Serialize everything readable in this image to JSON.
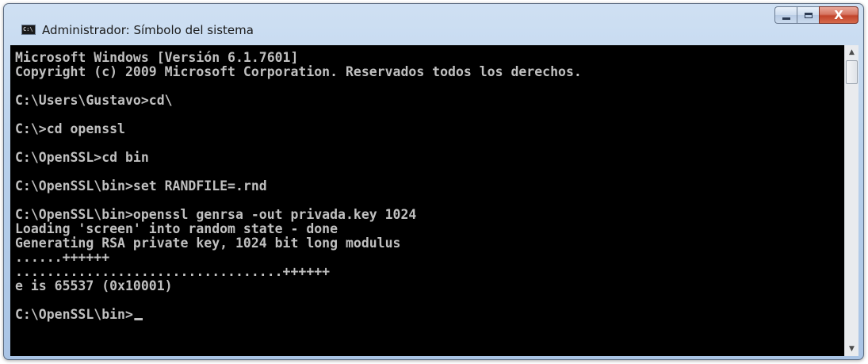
{
  "window": {
    "title": "Administrador: Símbolo del sistema",
    "icon_label": "C:\\",
    "close_glyph": "X"
  },
  "console": {
    "lines": [
      "Microsoft Windows [Versión 6.1.7601]",
      "Copyright (c) 2009 Microsoft Corporation. Reservados todos los derechos.",
      "",
      "C:\\Users\\Gustavo>cd\\",
      "",
      "C:\\>cd openssl",
      "",
      "C:\\OpenSSL>cd bin",
      "",
      "C:\\OpenSSL\\bin>set RANDFILE=.rnd",
      "",
      "C:\\OpenSSL\\bin>openssl genrsa -out privada.key 1024",
      "Loading 'screen' into random state - done",
      "Generating RSA private key, 1024 bit long modulus",
      "......++++++",
      "..................................++++++",
      "e is 65537 (0x10001)",
      "",
      "C:\\OpenSSL\\bin>"
    ]
  },
  "colors": {
    "console_background": "#000000",
    "console_text": "#c0c0c0",
    "close_button": "#c1432b"
  },
  "icons": {
    "app": "cmd-icon",
    "minimize": "minimize-icon",
    "maximize": "maximize-icon",
    "close": "close-icon",
    "scroll_up": "scroll-up-arrow-icon",
    "scroll_down": "scroll-down-arrow-icon"
  }
}
